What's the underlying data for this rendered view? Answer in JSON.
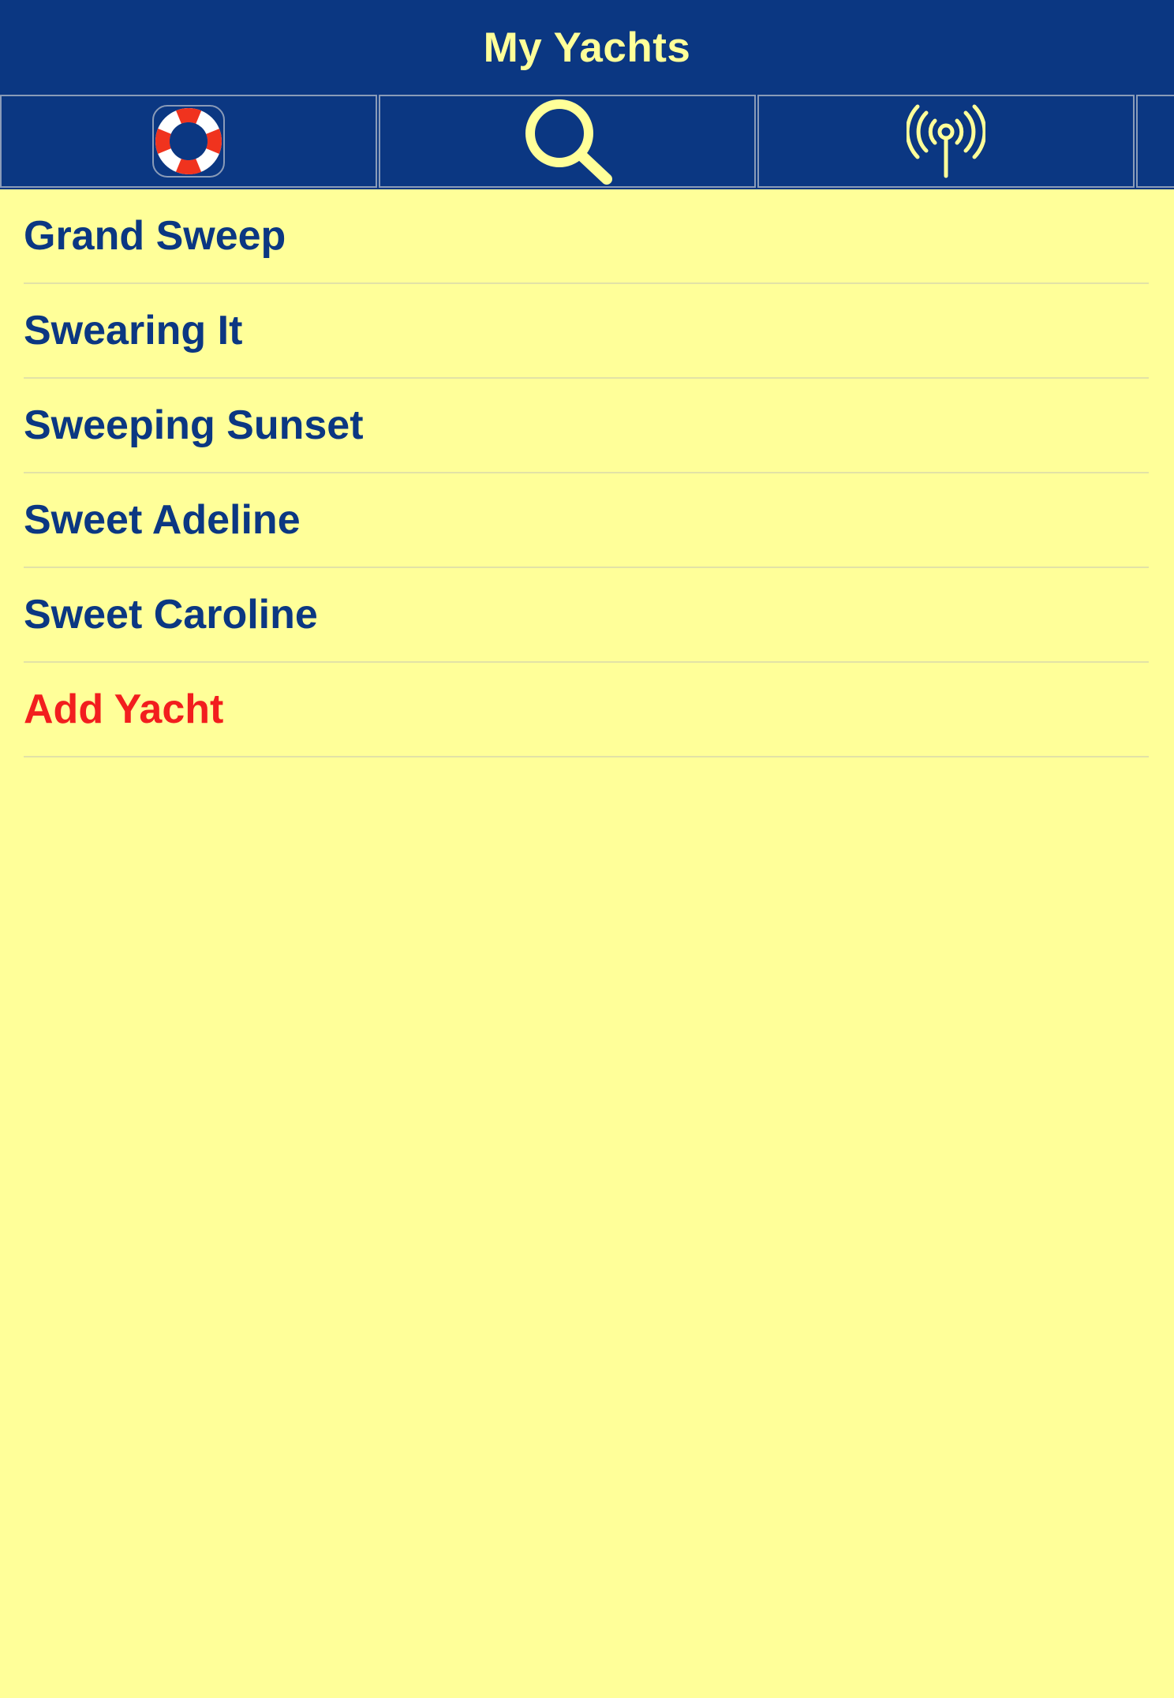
{
  "app": {
    "title": "My Yachts"
  },
  "toolbar": {
    "buttons": [
      {
        "icon": "lifebuoy-icon"
      },
      {
        "icon": "search-icon"
      },
      {
        "icon": "antenna-icon"
      },
      {
        "icon": "more-icon"
      }
    ]
  },
  "yachts": {
    "items": [
      {
        "label": "Grand Sweep"
      },
      {
        "label": "Swearing It"
      },
      {
        "label": "Sweeping Sunset"
      },
      {
        "label": "Sweet Adeline"
      },
      {
        "label": "Sweet Caroline"
      }
    ],
    "add_label": "Add Yacht"
  },
  "colors": {
    "nav_background": "#0B3782",
    "accent_text": "#FFFF99",
    "list_background": "#FFFF99",
    "item_text": "#0B3782",
    "add_text": "#F21E1E"
  }
}
